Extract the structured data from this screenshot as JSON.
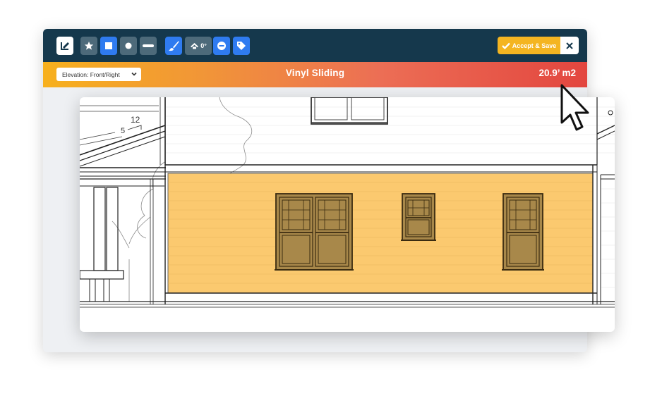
{
  "toolbar": {
    "tools": [
      {
        "name": "edit-tool",
        "icon": "edit-icon",
        "style": "white"
      },
      {
        "name": "star-tool",
        "icon": "star-icon",
        "style": "grey"
      },
      {
        "name": "square-tool",
        "icon": "square-icon",
        "style": "blue"
      },
      {
        "name": "circle-tool",
        "icon": "circle-icon",
        "style": "grey"
      },
      {
        "name": "line-tool",
        "icon": "line-icon",
        "style": "grey"
      },
      {
        "name": "brush-tool",
        "icon": "brush-icon",
        "style": "blue"
      },
      {
        "name": "pitch-tool",
        "icon": "roof-icon",
        "style": "grey"
      },
      {
        "name": "minus-tool",
        "icon": "minus-circle-icon",
        "style": "blue"
      },
      {
        "name": "tag-tool",
        "icon": "tag-icon",
        "style": "blue"
      }
    ],
    "angle_label": "0°",
    "accept_label": "Accept & Save",
    "accept_icon": "check-icon",
    "close_icon": "close-icon",
    "colors": {
      "bar": "#15384c",
      "grey_button": "#4d6a7a",
      "blue_button": "#2f7bf0",
      "accept": "#f4b521"
    }
  },
  "infobar": {
    "elevation_select": "Elevation: Front/Right",
    "material": "Vinyl Sliding",
    "area": "20.9’ m2",
    "gradient": [
      "#f7b01d",
      "#f19538",
      "#ec6e55",
      "#e3463f"
    ]
  },
  "drawing": {
    "pitch_rise": "12",
    "pitch_run": "5",
    "siding_color": "#fbc96f",
    "window_color": "#a8884a"
  }
}
